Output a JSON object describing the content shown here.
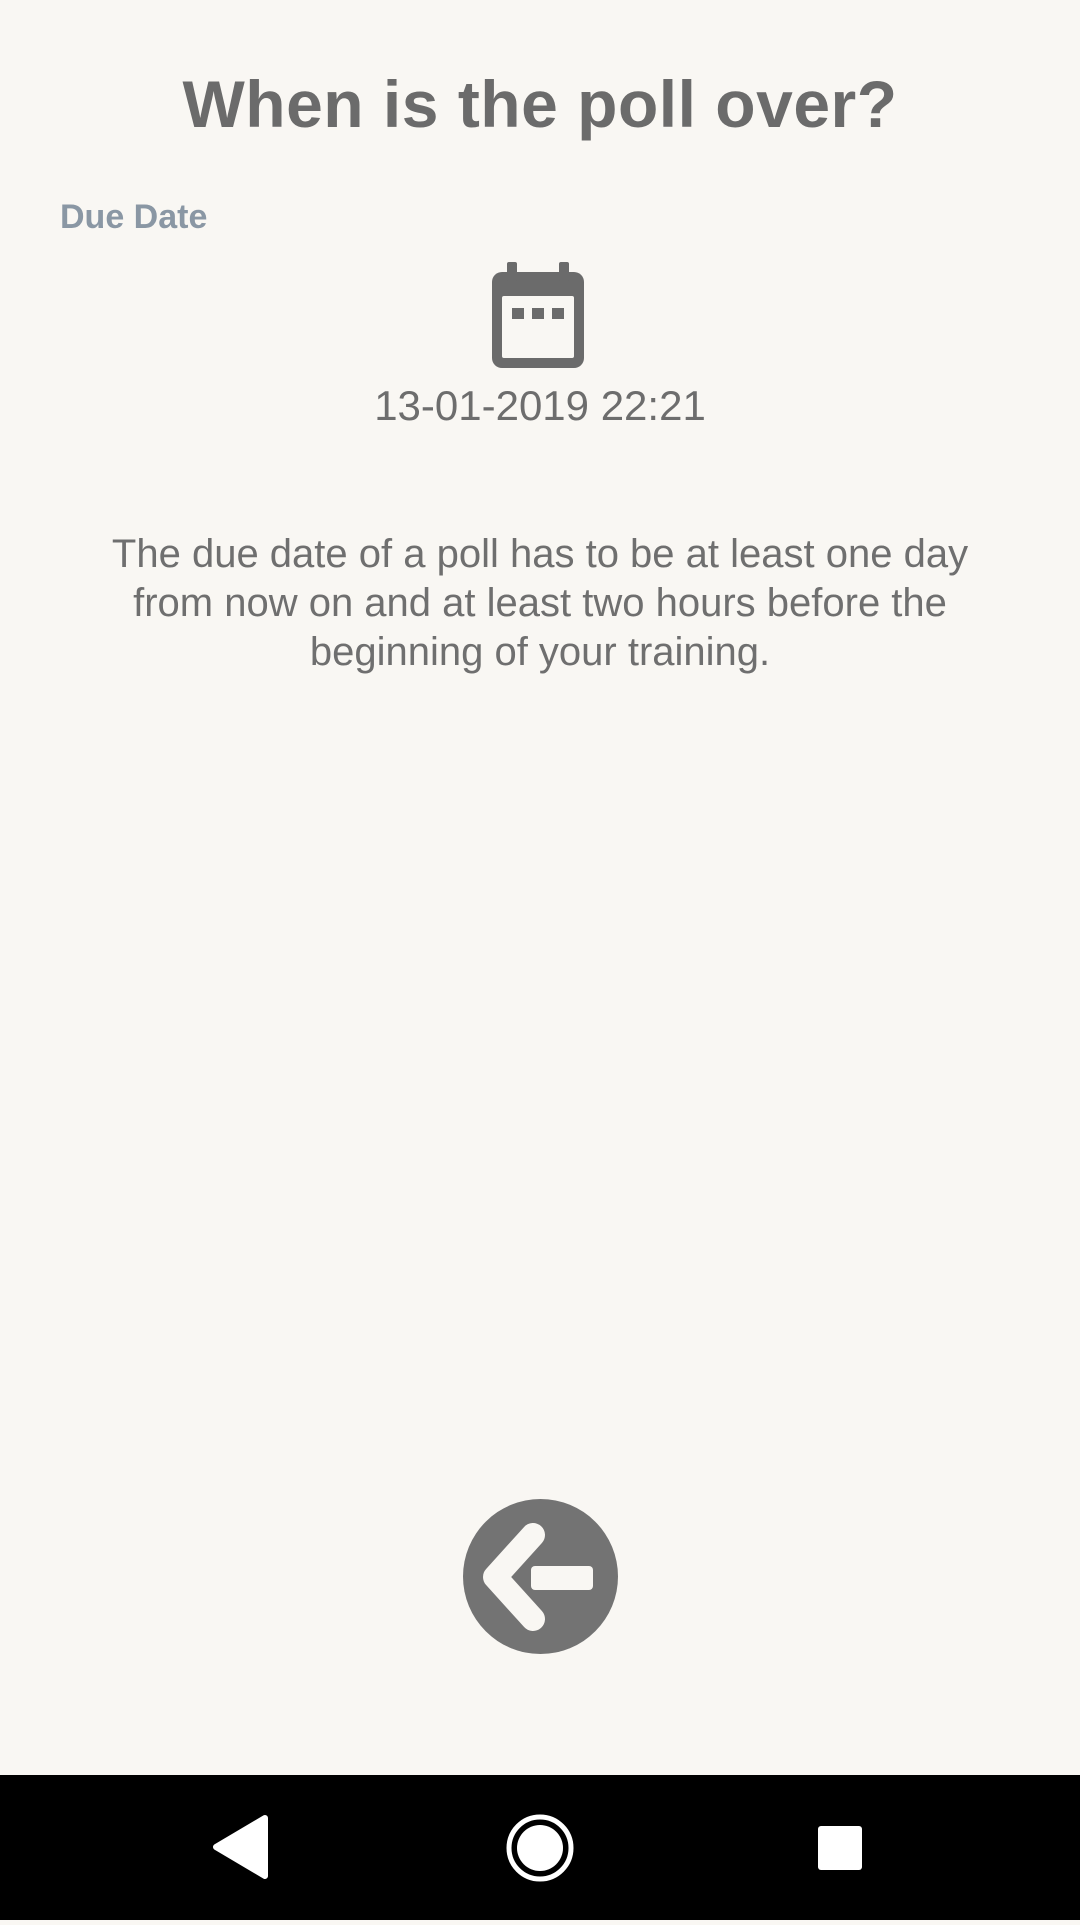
{
  "screen": {
    "title": "When is the poll over?",
    "due_date_label": "Due Date",
    "due_date_value": "13-01-2019 22:21",
    "info_text": "The due date of a poll has to be at least one day from now on and at least two hours before the beginning of your training."
  },
  "icons": {
    "date_picker": "calendar-icon",
    "back_button": "arrow-left-icon"
  },
  "colors": {
    "background": "#f9f7f3",
    "text": "#6d6d6d",
    "label": "#8a97a4",
    "fab": "#737373",
    "nav_bar": "#000000"
  }
}
